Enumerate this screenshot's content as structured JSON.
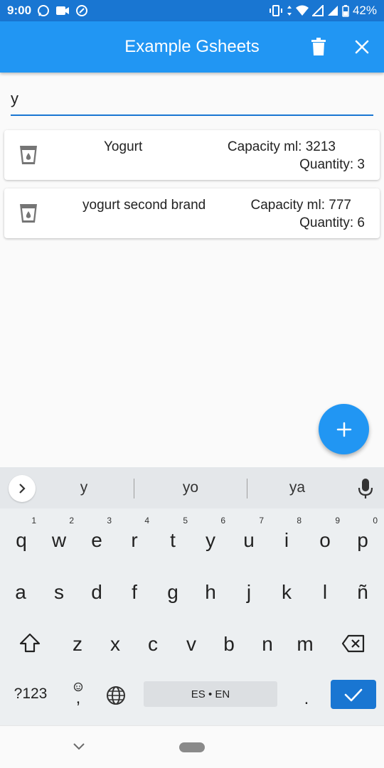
{
  "status_bar": {
    "time": "9:00",
    "battery": "42%"
  },
  "app_bar": {
    "title": "Example Gsheets"
  },
  "search": {
    "value": "y"
  },
  "items": [
    {
      "name": "Yogurt",
      "capacity": "Capacity ml: 3213",
      "quantity": "Quantity:  3"
    },
    {
      "name": "yogurt second brand",
      "capacity": "Capacity ml: 777",
      "quantity": "Quantity:  6"
    }
  ],
  "keyboard": {
    "suggestions": [
      "y",
      "yo",
      "ya"
    ],
    "row1": [
      {
        "l": "q",
        "h": "1"
      },
      {
        "l": "w",
        "h": "2"
      },
      {
        "l": "e",
        "h": "3"
      },
      {
        "l": "r",
        "h": "4"
      },
      {
        "l": "t",
        "h": "5"
      },
      {
        "l": "y",
        "h": "6"
      },
      {
        "l": "u",
        "h": "7"
      },
      {
        "l": "i",
        "h": "8"
      },
      {
        "l": "o",
        "h": "9"
      },
      {
        "l": "p",
        "h": "0"
      }
    ],
    "row2": [
      "a",
      "s",
      "d",
      "f",
      "g",
      "h",
      "j",
      "k",
      "l",
      "ñ"
    ],
    "row3": [
      "z",
      "x",
      "c",
      "v",
      "b",
      "n",
      "m"
    ],
    "symbols_label": "?123",
    "comma_label": ",",
    "space_label": "ES • EN",
    "period_label": "."
  },
  "colors": {
    "primary": "#2196f3",
    "primary_dark": "#1976d2"
  }
}
